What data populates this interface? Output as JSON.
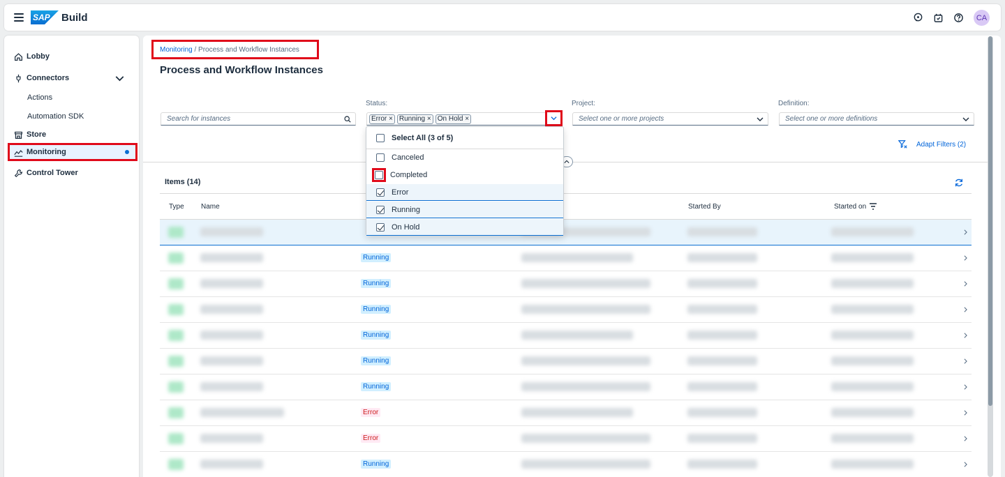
{
  "shell": {
    "logo": "SAP",
    "product": "Build",
    "avatar_initials": "CA"
  },
  "sidebar": {
    "items": [
      {
        "label": "Lobby",
        "icon": "home-icon"
      },
      {
        "label": "Connectors",
        "icon": "connector-icon"
      },
      {
        "label": "Store",
        "icon": "store-icon"
      },
      {
        "label": "Monitoring",
        "icon": "monitoring-icon"
      },
      {
        "label": "Control Tower",
        "icon": "wrench-icon"
      }
    ],
    "sub_items": [
      "Actions",
      "Automation SDK"
    ]
  },
  "breadcrumb": {
    "link": "Monitoring",
    "separator": " / ",
    "current": "Process and Workflow Instances"
  },
  "page_title": "Process and Workflow Instances",
  "filters": {
    "search_placeholder": "Search for instances",
    "status_label": "Status:",
    "status_tokens": [
      "Error",
      "Running",
      "On Hold"
    ],
    "project_label": "Project:",
    "project_placeholder": "Select one or more projects",
    "definition_label": "Definition:",
    "definition_placeholder": "Select one or more definitions",
    "adapt_label": "Adapt Filters (2)"
  },
  "status_dropdown": {
    "select_all": "Select All (3 of 5)",
    "options": [
      {
        "label": "Canceled",
        "checked": false
      },
      {
        "label": "Completed",
        "checked": false
      },
      {
        "label": "Error",
        "checked": true
      },
      {
        "label": "Running",
        "checked": true
      },
      {
        "label": "On Hold",
        "checked": true
      }
    ]
  },
  "table": {
    "title": "Items (14)",
    "columns": {
      "type": "Type",
      "name": "Name",
      "started_by": "Started By",
      "started_on": "Started on"
    },
    "rows": [
      {
        "status": ""
      },
      {
        "status": "Running"
      },
      {
        "status": "Running"
      },
      {
        "status": "Running"
      },
      {
        "status": "Running"
      },
      {
        "status": "Running"
      },
      {
        "status": "Running"
      },
      {
        "status": "Error"
      },
      {
        "status": "Error"
      },
      {
        "status": "Running"
      }
    ]
  }
}
